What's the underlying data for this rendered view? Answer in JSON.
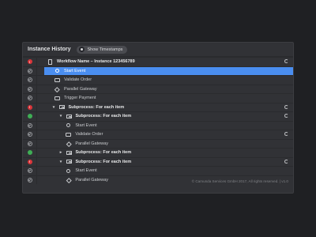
{
  "panel": {
    "title": "Instance History",
    "timestamps_button": "Show Timestamps"
  },
  "rows": [
    {
      "label": "Workflow Name – Instance 123456789",
      "status": "err",
      "icon": "doc",
      "indent": 0,
      "bold": true,
      "retry": true,
      "chevron": ""
    },
    {
      "label": "Start Event",
      "status": "ok",
      "icon": "circle",
      "indent": 1,
      "bold": false,
      "selected": true,
      "chevron": ""
    },
    {
      "label": "Validate Order",
      "status": "ok",
      "icon": "task",
      "indent": 1,
      "bold": false,
      "chevron": ""
    },
    {
      "label": "Parallel Gateway",
      "status": "ok",
      "icon": "gateway",
      "indent": 1,
      "bold": false,
      "chevron": ""
    },
    {
      "label": "Trigger Payment",
      "status": "ok",
      "icon": "task",
      "indent": 1,
      "bold": false,
      "chevron": ""
    },
    {
      "label": "Subprocess: For each item",
      "status": "err",
      "icon": "sub",
      "indent": 0.5,
      "bold": true,
      "retry": true,
      "chevron": "▾"
    },
    {
      "label": "Subprocess: For each item",
      "status": "active",
      "icon": "sub",
      "indent": 1.5,
      "bold": true,
      "retry": true,
      "chevron": "▾"
    },
    {
      "label": "Start Event",
      "status": "ok",
      "icon": "circle",
      "indent": 2.6,
      "bold": false,
      "chevron": ""
    },
    {
      "label": "Validate Order",
      "status": "ok",
      "icon": "task",
      "indent": 2.6,
      "bold": false,
      "retry": true,
      "chevron": ""
    },
    {
      "label": "Parallel Gateway",
      "status": "ok",
      "icon": "gateway",
      "indent": 2.6,
      "bold": false,
      "chevron": ""
    },
    {
      "label": "Subprocess: For each item",
      "status": "active",
      "icon": "sub",
      "indent": 1.5,
      "bold": true,
      "chevron": "▸"
    },
    {
      "label": "Subprocess: For each item",
      "status": "err",
      "icon": "sub",
      "indent": 1.5,
      "bold": true,
      "retry": true,
      "chevron": "▾"
    },
    {
      "label": "Start Event",
      "status": "ok",
      "icon": "circle",
      "indent": 2.6,
      "bold": false,
      "chevron": ""
    },
    {
      "label": "Parallel Gateway",
      "status": "ok",
      "icon": "gateway",
      "indent": 2.6,
      "bold": false,
      "chevron": ""
    }
  ],
  "footer": "© Camunda Services GmbH 2017, All rights reserved. | v1.0",
  "colors": {
    "selected": "#4a8ef0",
    "error": "#d9353a",
    "active": "#3fae55"
  }
}
